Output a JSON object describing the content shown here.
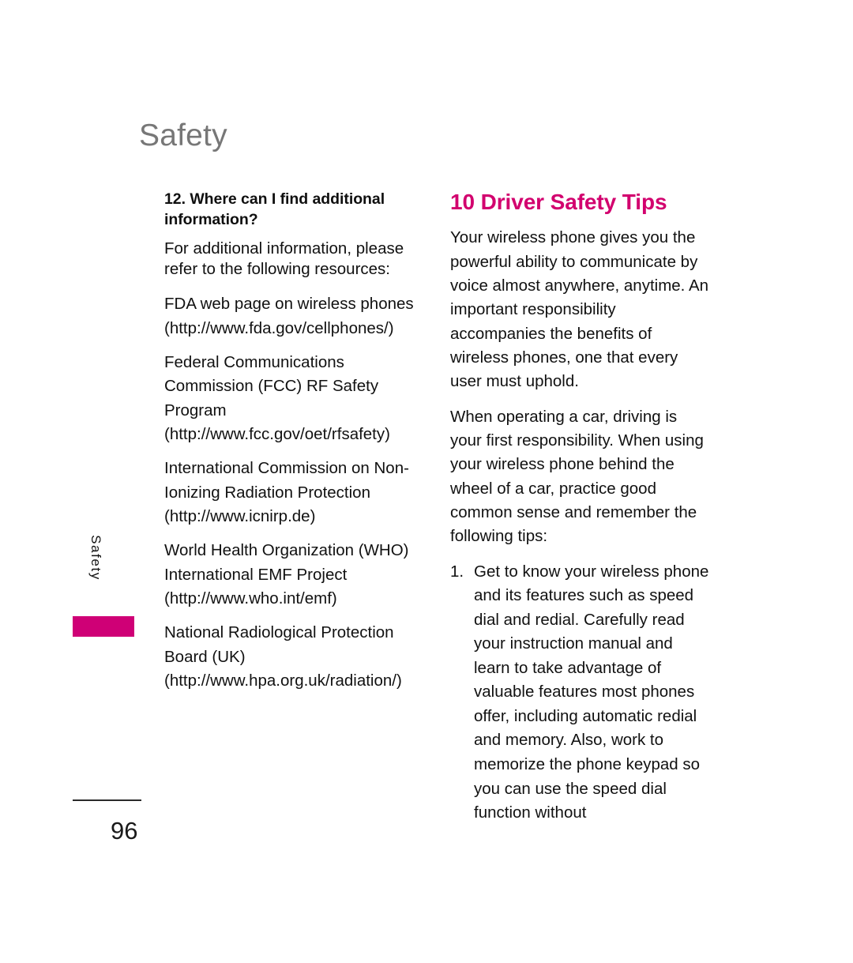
{
  "document": {
    "running_header": "Safety",
    "page_number": "96",
    "side_tab_label": "Safety",
    "accent_color": "#cf0076",
    "heading_color": "#d2006e",
    "header_color": "#777777"
  },
  "left_column": {
    "question_heading": "12. Where can I find additional information?",
    "intro": "For additional information, please refer to the following resources:",
    "resources": [
      "FDA web page on wireless phones (http://www.fda.gov/cellphones/)",
      "Federal Communications Commission (FCC) RF Safety Program (http://www.fcc.gov/oet/rfsafety)",
      "International Commission on Non-Ionizing Radiation Protection (http://www.icnirp.de)",
      "World Health Organization (WHO) International EMF Project (http://www.who.int/emf)",
      "National Radiological Protection Board (UK) (http://www.hpa.org.uk/radiation/)"
    ]
  },
  "right_column": {
    "section_heading": "10 Driver Safety Tips",
    "paragraphs": [
      "Your wireless phone gives you the powerful ability to communicate by voice almost anywhere, anytime. An important responsibility accompanies the benefits of wireless phones, one that every user must uphold.",
      "When operating a car, driving is your first responsibility. When using your wireless phone behind the wheel of a car, practice good common sense and remember the following tips:"
    ],
    "tips": [
      {
        "number": "1.",
        "text": "Get to know your wireless phone and its features such as speed dial and redial. Carefully read your instruction manual and learn to take advantage of valuable features most phones offer, including automatic redial and memory. Also, work to memorize the phone keypad so you can use the speed dial function without"
      }
    ]
  }
}
